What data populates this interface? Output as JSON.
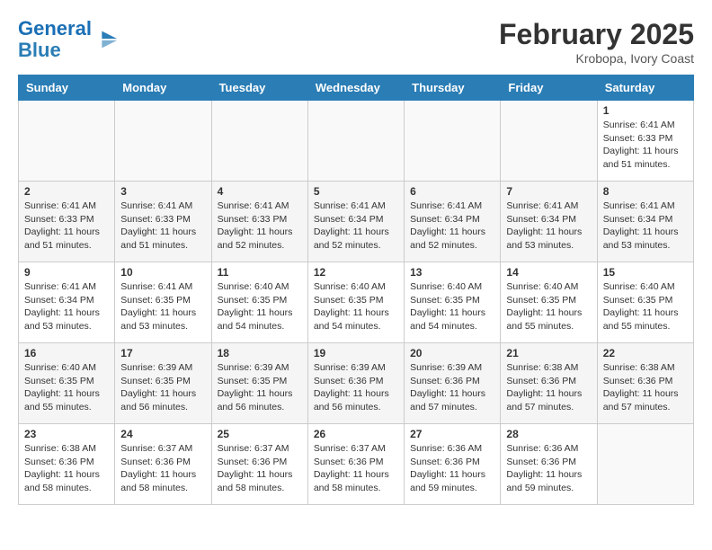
{
  "logo": {
    "line1": "General",
    "line2": "Blue"
  },
  "title": "February 2025",
  "subtitle": "Krobopa, Ivory Coast",
  "days_of_week": [
    "Sunday",
    "Monday",
    "Tuesday",
    "Wednesday",
    "Thursday",
    "Friday",
    "Saturday"
  ],
  "weeks": [
    [
      {
        "day": "",
        "info": ""
      },
      {
        "day": "",
        "info": ""
      },
      {
        "day": "",
        "info": ""
      },
      {
        "day": "",
        "info": ""
      },
      {
        "day": "",
        "info": ""
      },
      {
        "day": "",
        "info": ""
      },
      {
        "day": "1",
        "info": "Sunrise: 6:41 AM\nSunset: 6:33 PM\nDaylight: 11 hours and 51 minutes."
      }
    ],
    [
      {
        "day": "2",
        "info": "Sunrise: 6:41 AM\nSunset: 6:33 PM\nDaylight: 11 hours and 51 minutes."
      },
      {
        "day": "3",
        "info": "Sunrise: 6:41 AM\nSunset: 6:33 PM\nDaylight: 11 hours and 51 minutes."
      },
      {
        "day": "4",
        "info": "Sunrise: 6:41 AM\nSunset: 6:33 PM\nDaylight: 11 hours and 52 minutes."
      },
      {
        "day": "5",
        "info": "Sunrise: 6:41 AM\nSunset: 6:34 PM\nDaylight: 11 hours and 52 minutes."
      },
      {
        "day": "6",
        "info": "Sunrise: 6:41 AM\nSunset: 6:34 PM\nDaylight: 11 hours and 52 minutes."
      },
      {
        "day": "7",
        "info": "Sunrise: 6:41 AM\nSunset: 6:34 PM\nDaylight: 11 hours and 53 minutes."
      },
      {
        "day": "8",
        "info": "Sunrise: 6:41 AM\nSunset: 6:34 PM\nDaylight: 11 hours and 53 minutes."
      }
    ],
    [
      {
        "day": "9",
        "info": "Sunrise: 6:41 AM\nSunset: 6:34 PM\nDaylight: 11 hours and 53 minutes."
      },
      {
        "day": "10",
        "info": "Sunrise: 6:41 AM\nSunset: 6:35 PM\nDaylight: 11 hours and 53 minutes."
      },
      {
        "day": "11",
        "info": "Sunrise: 6:40 AM\nSunset: 6:35 PM\nDaylight: 11 hours and 54 minutes."
      },
      {
        "day": "12",
        "info": "Sunrise: 6:40 AM\nSunset: 6:35 PM\nDaylight: 11 hours and 54 minutes."
      },
      {
        "day": "13",
        "info": "Sunrise: 6:40 AM\nSunset: 6:35 PM\nDaylight: 11 hours and 54 minutes."
      },
      {
        "day": "14",
        "info": "Sunrise: 6:40 AM\nSunset: 6:35 PM\nDaylight: 11 hours and 55 minutes."
      },
      {
        "day": "15",
        "info": "Sunrise: 6:40 AM\nSunset: 6:35 PM\nDaylight: 11 hours and 55 minutes."
      }
    ],
    [
      {
        "day": "16",
        "info": "Sunrise: 6:40 AM\nSunset: 6:35 PM\nDaylight: 11 hours and 55 minutes."
      },
      {
        "day": "17",
        "info": "Sunrise: 6:39 AM\nSunset: 6:35 PM\nDaylight: 11 hours and 56 minutes."
      },
      {
        "day": "18",
        "info": "Sunrise: 6:39 AM\nSunset: 6:35 PM\nDaylight: 11 hours and 56 minutes."
      },
      {
        "day": "19",
        "info": "Sunrise: 6:39 AM\nSunset: 6:36 PM\nDaylight: 11 hours and 56 minutes."
      },
      {
        "day": "20",
        "info": "Sunrise: 6:39 AM\nSunset: 6:36 PM\nDaylight: 11 hours and 57 minutes."
      },
      {
        "day": "21",
        "info": "Sunrise: 6:38 AM\nSunset: 6:36 PM\nDaylight: 11 hours and 57 minutes."
      },
      {
        "day": "22",
        "info": "Sunrise: 6:38 AM\nSunset: 6:36 PM\nDaylight: 11 hours and 57 minutes."
      }
    ],
    [
      {
        "day": "23",
        "info": "Sunrise: 6:38 AM\nSunset: 6:36 PM\nDaylight: 11 hours and 58 minutes."
      },
      {
        "day": "24",
        "info": "Sunrise: 6:37 AM\nSunset: 6:36 PM\nDaylight: 11 hours and 58 minutes."
      },
      {
        "day": "25",
        "info": "Sunrise: 6:37 AM\nSunset: 6:36 PM\nDaylight: 11 hours and 58 minutes."
      },
      {
        "day": "26",
        "info": "Sunrise: 6:37 AM\nSunset: 6:36 PM\nDaylight: 11 hours and 58 minutes."
      },
      {
        "day": "27",
        "info": "Sunrise: 6:36 AM\nSunset: 6:36 PM\nDaylight: 11 hours and 59 minutes."
      },
      {
        "day": "28",
        "info": "Sunrise: 6:36 AM\nSunset: 6:36 PM\nDaylight: 11 hours and 59 minutes."
      },
      {
        "day": "",
        "info": ""
      }
    ]
  ]
}
